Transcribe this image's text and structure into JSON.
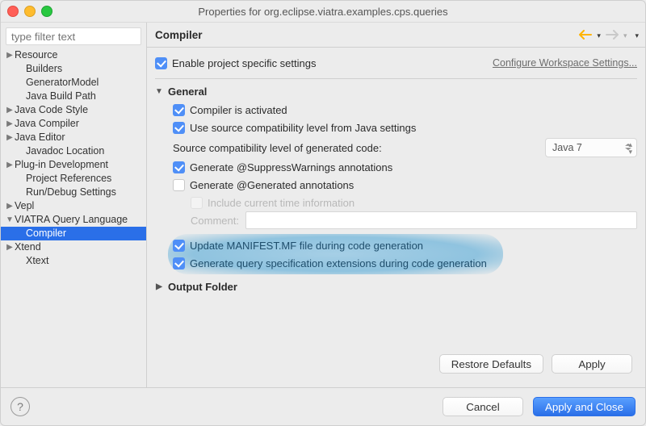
{
  "window": {
    "title": "Properties for org.eclipse.viatra.examples.cps.queries"
  },
  "filter": {
    "placeholder": "type filter text"
  },
  "tree": {
    "items": [
      {
        "label": "Resource",
        "depth": 0,
        "caret": "right"
      },
      {
        "label": "Builders",
        "depth": 1
      },
      {
        "label": "GeneratorModel",
        "depth": 1
      },
      {
        "label": "Java Build Path",
        "depth": 1
      },
      {
        "label": "Java Code Style",
        "depth": 0,
        "caret": "right"
      },
      {
        "label": "Java Compiler",
        "depth": 0,
        "caret": "right"
      },
      {
        "label": "Java Editor",
        "depth": 0,
        "caret": "right"
      },
      {
        "label": "Javadoc Location",
        "depth": 1
      },
      {
        "label": "Plug-in Development",
        "depth": 0,
        "caret": "right"
      },
      {
        "label": "Project References",
        "depth": 1
      },
      {
        "label": "Run/Debug Settings",
        "depth": 1
      },
      {
        "label": "Vepl",
        "depth": 0,
        "caret": "right"
      },
      {
        "label": "VIATRA Query Language",
        "depth": 0,
        "caret": "down"
      },
      {
        "label": "Compiler",
        "depth": 1,
        "selected": true
      },
      {
        "label": "Xtend",
        "depth": 0,
        "caret": "right"
      },
      {
        "label": "Xtext",
        "depth": 1
      }
    ]
  },
  "header": {
    "title": "Compiler"
  },
  "settings": {
    "enable_label": "Enable project specific settings",
    "config_link": "Configure Workspace Settings..."
  },
  "general": {
    "title": "General",
    "compiler_activated": "Compiler is activated",
    "use_source_compat": "Use source compatibility level from Java settings",
    "level_label": "Source compatibility level of generated code:",
    "level_value": "Java 7",
    "gen_suppress": "Generate @SuppressWarnings annotations",
    "gen_generated": "Generate @Generated annotations",
    "include_time": "Include current time information",
    "comment_label": "Comment:",
    "update_manifest": "Update MANIFEST.MF file during code generation",
    "gen_query_ext": "Generate query specification extensions during code generation"
  },
  "output_folder": {
    "title": "Output Folder"
  },
  "buttons": {
    "restore": "Restore Defaults",
    "apply": "Apply",
    "cancel": "Cancel",
    "apply_close": "Apply and Close"
  }
}
